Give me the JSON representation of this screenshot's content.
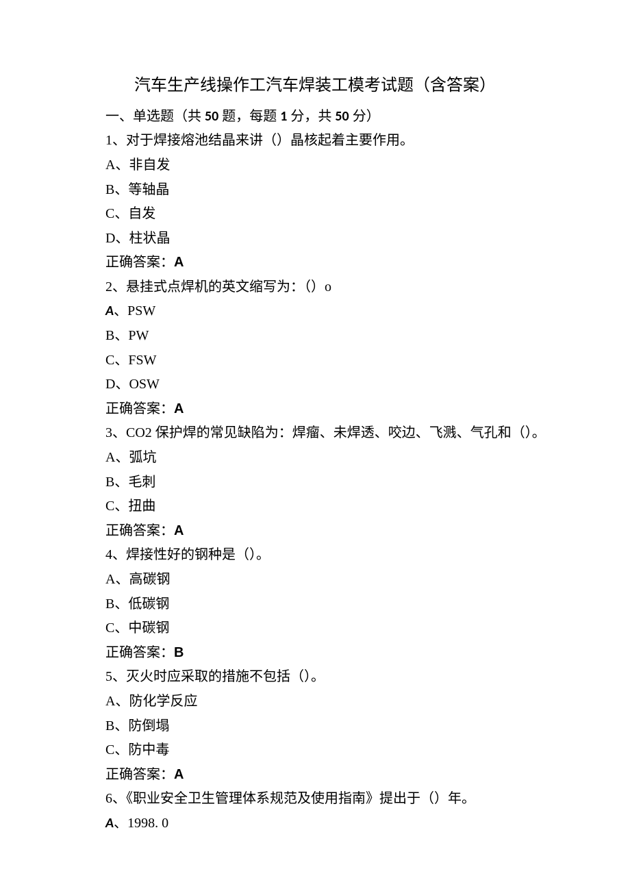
{
  "title": "汽车生产线操作工汽车焊装工模考试题（含答案）",
  "section": {
    "prefix": "一、单选题（共 ",
    "count1": "50",
    "mid1": " 题，每题 ",
    "perscore": "1",
    "mid2": " 分，共 ",
    "count2": "50",
    "suffix": " 分）"
  },
  "q1": {
    "stem": "1、对于焊接熔池结晶来讲（）晶核起着主要作用。",
    "A": "A、非自发",
    "B": "B、等轴晶",
    "C": "C、自发",
    "D": "D、柱状晶",
    "ansLabel": "正确答案：",
    "ansVal": "A"
  },
  "q2": {
    "stem": "2、悬挂式点焊机的英文缩写为：（）o",
    "A_prefix": "A",
    "A_rest": "、PSW",
    "B": "B、PW",
    "C": "C、FSW",
    "D": "D、OSW",
    "ansLabel": "正确答案：",
    "ansVal": "A"
  },
  "q3": {
    "stem": "3、CO2 保护焊的常见缺陷为：焊瘤、未焊透、咬边、飞溅、气孔和（）。",
    "A": "A、弧坑",
    "B": "B、毛刺",
    "C": "C、扭曲",
    "ansLabel": "正确答案：",
    "ansVal": "A"
  },
  "q4": {
    "stem": "4、焊接性好的钢种是（）。",
    "A": "A、高碳钢",
    "B": "B、低碳钢",
    "C": "C、中碳钢",
    "ansLabel": "正确答案：",
    "ansVal": "B"
  },
  "q5": {
    "stem": "5、灭火时应采取的措施不包括（）。",
    "A": "A、防化学反应",
    "B": "B、防倒塌",
    "C": "C、防中毒",
    "ansLabel": "正确答案：",
    "ansVal": "A"
  },
  "q6": {
    "stem": "6、《职业安全卫生管理体系规范及使用指南》提出于（）年。",
    "A_prefix": "A",
    "A_rest": "、1998. 0"
  }
}
